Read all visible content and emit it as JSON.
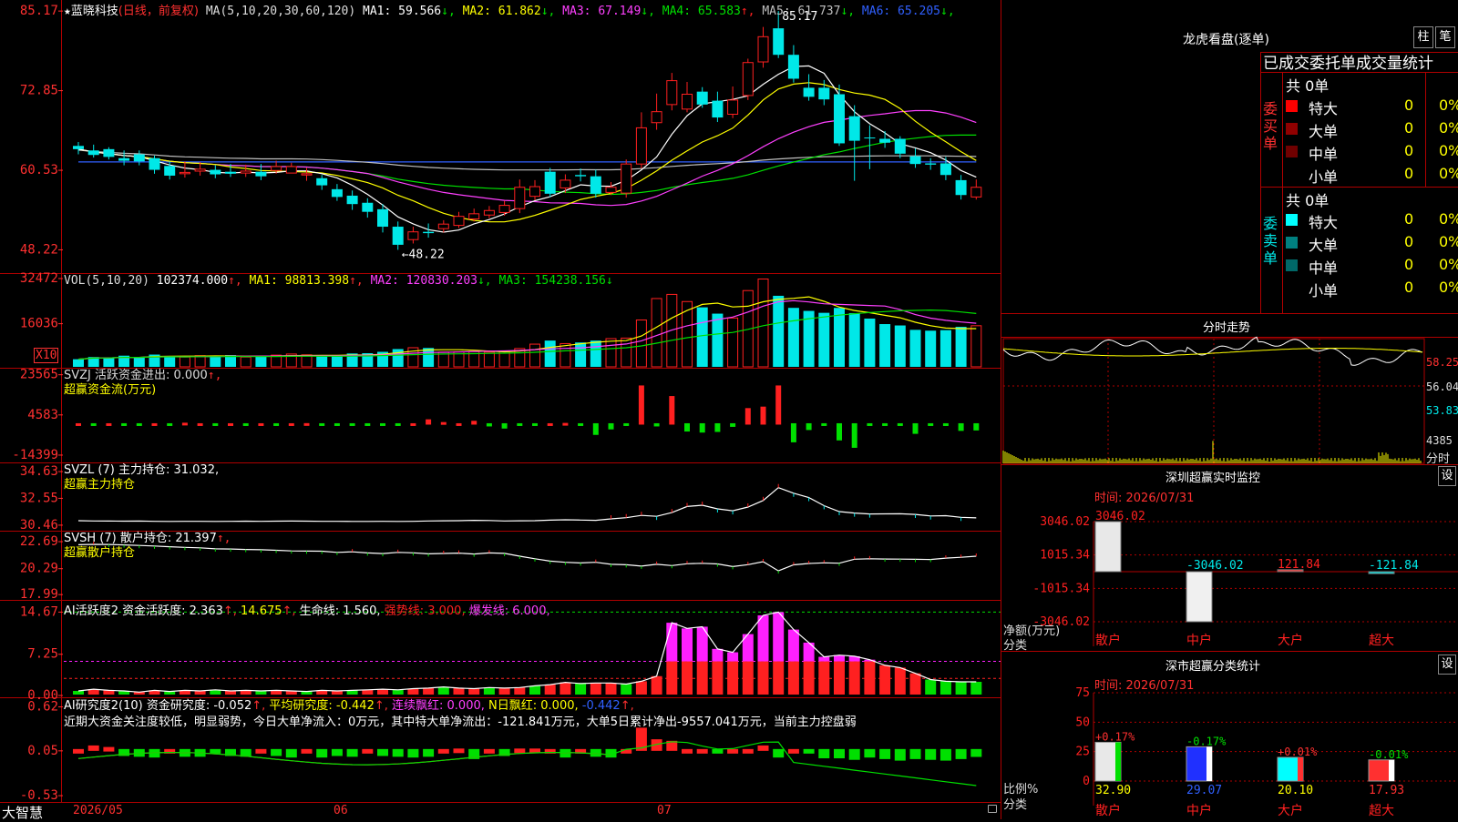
{
  "stock": {
    "name": "蓝晓科技",
    "mode": "(日线，前复权)"
  },
  "colors": {
    "up": "#ff2020",
    "down": "#00e8e8",
    "grid": "#a00000",
    "ma1": "#ffffff",
    "ma2": "#ffff00",
    "ma3": "#ff40ff",
    "ma4": "#00e000",
    "ma5": "#c0c0c0",
    "ma6": "#3060ff",
    "green": "#00e000",
    "magenta": "#ff20ff",
    "yellow": "#ffff00"
  },
  "price_panel": {
    "ma_label": "MA(5,10,20,30,60,120)",
    "ma_values": [
      {
        "label": "MA1:",
        "value": "59.566",
        "arrow": "↓",
        "color": "#ffffff"
      },
      {
        "label": "MA2:",
        "value": "61.862",
        "arrow": "↓",
        "color": "#ffff00"
      },
      {
        "label": "MA3:",
        "value": "67.149",
        "arrow": "↓",
        "color": "#ff40ff"
      },
      {
        "label": "MA4:",
        "value": "65.583",
        "arrow": "↑",
        "color": "#00e000"
      },
      {
        "label": "MA5:",
        "value": "61.737",
        "arrow": "↓",
        "color": "#c0c0c0"
      },
      {
        "label": "MA6:",
        "value": "65.205",
        "arrow": "↓",
        "color": "#3060ff"
      }
    ],
    "y_ticks": [
      "85.17",
      "72.85",
      "60.53",
      "48.22"
    ],
    "high_note": "85.17",
    "low_note": "←48.22"
  },
  "vol_panel": {
    "title": "VOL(5,10,20)",
    "value": "102374.000",
    "ma1": "MA1: 98813.398",
    "ma2": "MA2: 120830.203",
    "ma3": "MA3: 154238.156",
    "y_ticks": [
      "32472",
      "16036"
    ],
    "unit": "X10"
  },
  "svzj_panel": {
    "title": "SVZJ  活跃资金进出: 0.000",
    "subtitle": "超赢资金流(万元)",
    "y_ticks": [
      "23565",
      "4583",
      "-14399"
    ]
  },
  "svzl_panel": {
    "title": "SVZL (7) 主力持仓: 31.032,",
    "subtitle": "超赢主力持仓",
    "y_ticks": [
      "34.63",
      "32.55",
      "30.46"
    ]
  },
  "svsh_panel": {
    "title": "SVSH (7) 散户持仓: 21.397",
    "subtitle": "超赢散户持仓",
    "y_ticks": [
      "22.69",
      "20.29",
      "17.99"
    ]
  },
  "ai_active_panel": {
    "title": "AI活跃度2 资金活跃度: 2.363",
    "v2": "14.675",
    "v3": "生命线: 1.560,",
    "v4": "强势线: 3.000,",
    "v5": "爆发线: 6.000,",
    "y_ticks": [
      "14.67",
      "7.25",
      "0.00"
    ]
  },
  "ai_research_panel": {
    "title": "AI研究度2(10) 资金研究度: -0.052",
    "v2": "平均研究度: -0.442",
    "v3": "连续飘红: 0.000,",
    "v4": "N日飘红: 0.000,",
    "v5": "-0.442",
    "comment": "近期大资金关注度较低，明显弱势，今日大单净流入：0万元，其中特大单净流出：-121.841万元，大单5日累计净出-9557.041万元，当前主力控盘弱",
    "y_ticks": [
      "0.62",
      "0.05",
      "-0.53"
    ]
  },
  "x_axis": {
    "labels": [
      "2026/05",
      "06",
      "07"
    ],
    "brand": "大智慧"
  },
  "dragon": {
    "title": "龙虎看盘(逐单)",
    "btn1": "柱",
    "btn2": "笔",
    "tabs_text": "已成交委托单成交量统计",
    "buy_label": "委买单",
    "sell_label": "委卖单",
    "buy_total": "共 0单",
    "sell_total": "共 0单",
    "buy_rows": [
      {
        "name": "特大",
        "count": "0",
        "pct": "0%",
        "color": "#ff0000"
      },
      {
        "name": "大单",
        "count": "0",
        "pct": "0%",
        "color": "#900000"
      },
      {
        "name": "中单",
        "count": "0",
        "pct": "0%",
        "color": "#700000"
      },
      {
        "name": "小单",
        "count": "0",
        "pct": "0%",
        "color": ""
      }
    ],
    "sell_rows": [
      {
        "name": "特大",
        "count": "0",
        "pct": "0%",
        "color": "#00ffff"
      },
      {
        "name": "大单",
        "count": "0",
        "pct": "0%",
        "color": "#008080"
      },
      {
        "name": "中单",
        "count": "0",
        "pct": "0%",
        "color": "#006868"
      },
      {
        "name": "小单",
        "count": "0",
        "pct": "0%",
        "color": ""
      }
    ]
  },
  "intraday": {
    "title": "分时走势",
    "y_labels": [
      "58.25",
      "56.04",
      "53.83"
    ],
    "vol_label": "4385",
    "x_label": "分时"
  },
  "monitor": {
    "title": "深圳超赢实时监控",
    "btn": "设",
    "time": "时间: 2026/07/31",
    "y_ticks": [
      "3046.02",
      "1015.34",
      "-1015.34",
      "-3046.02"
    ],
    "unit": "净额(万元)",
    "cat_label": "分类"
  },
  "classify": {
    "title": "深市超赢分类统计",
    "btn": "设",
    "time": "时间: 2026/07/31",
    "y_ticks": [
      "75",
      "50",
      "25",
      "0"
    ],
    "unit": "比例%",
    "cat_label": "分类"
  },
  "chart_data": [
    {
      "type": "candlestick",
      "title": "蓝晓科技 (日线，前复权)",
      "x": [
        "2026/05",
        "06",
        "07"
      ],
      "open": [
        64.3,
        63.6,
        63.8,
        62.4,
        63.0,
        62.4,
        61.2,
        60.0,
        60.4,
        60.6,
        60.3,
        60.1,
        60.3,
        60.5,
        60.1,
        59.8,
        59.3,
        57.6,
        56.6,
        55.5,
        54.5,
        51.8,
        49.8,
        51.0,
        51.5,
        52.0,
        53.0,
        53.6,
        54.0,
        54.6,
        56.5,
        60.3,
        57.8,
        59.8,
        59.6,
        57.1,
        57.0,
        61.5,
        67.9,
        70.7,
        70.0,
        72.7,
        71.3,
        69.2,
        72.1,
        77.3,
        82.5,
        78.4,
        73.3,
        73.3,
        72.3,
        68.9,
        65.6,
        65.4,
        65.4,
        62.7,
        61.6,
        61.6,
        59.0,
        56.4
      ],
      "close": [
        63.8,
        62.9,
        62.6,
        62.0,
        61.9,
        60.6,
        59.7,
        60.2,
        60.7,
        59.9,
        60.0,
        60.4,
        59.6,
        61.1,
        61.1,
        60.0,
        58.2,
        56.4,
        55.3,
        54.1,
        51.8,
        49.0,
        51.0,
        50.8,
        52.2,
        53.4,
        53.8,
        54.3,
        55.1,
        57.9,
        58.0,
        56.9,
        59.0,
        59.6,
        56.9,
        57.9,
        61.5,
        67.1,
        69.6,
        74.4,
        72.3,
        70.7,
        68.7,
        71.4,
        77.2,
        81.2,
        78.4,
        74.7,
        71.9,
        71.5,
        64.7,
        65.1,
        65.5,
        64.8,
        63.1,
        61.5,
        61.4,
        59.8,
        56.7,
        57.9
      ],
      "high": [
        64.9,
        64.5,
        64.1,
        63.6,
        63.6,
        62.8,
        61.9,
        61.9,
        61.8,
        61.3,
        61.5,
        61.4,
        61.5,
        62.0,
        61.7,
        60.9,
        59.8,
        58.4,
        57.4,
        56.2,
        55.3,
        52.6,
        51.8,
        52.3,
        52.8,
        54.1,
        54.6,
        55.0,
        55.8,
        59.1,
        59.0,
        60.9,
        59.9,
        60.8,
        60.6,
        58.7,
        62.2,
        69.5,
        72.4,
        75.6,
        74.2,
        73.4,
        72.7,
        73.5,
        77.8,
        82.7,
        85.17,
        79.9,
        75.4,
        74.5,
        73.8,
        70.6,
        67.5,
        66.6,
        65.8,
        63.9,
        62.4,
        62.6,
        59.8,
        59.1
      ],
      "low": [
        63.0,
        62.5,
        62.2,
        61.3,
        61.3,
        60.0,
        59.1,
        59.4,
        59.7,
        59.3,
        59.5,
        59.5,
        59.0,
        60.0,
        60.1,
        58.9,
        57.5,
        55.8,
        54.4,
        53.2,
        50.9,
        48.22,
        49.2,
        50.1,
        50.9,
        51.6,
        52.6,
        53.1,
        53.5,
        53.9,
        55.9,
        56.4,
        57.0,
        58.8,
        56.3,
        56.7,
        56.3,
        60.8,
        66.8,
        69.8,
        69.5,
        70.2,
        68.0,
        68.6,
        71.4,
        76.4,
        77.9,
        74.1,
        71.3,
        70.6,
        64.3,
        58.9,
        60.7,
        64.0,
        62.4,
        60.9,
        60.6,
        59.0,
        56.0,
        56.0
      ],
      "ylim": [
        44.9,
        86.6
      ],
      "y_ticks": [
        85.17,
        72.85,
        60.53,
        48.22
      ]
    },
    {
      "type": "bar",
      "title": "VOL(5,10,20)",
      "values": [
        3100,
        3900,
        3700,
        4400,
        3800,
        4800,
        4300,
        3900,
        4400,
        4200,
        4600,
        3900,
        4100,
        4600,
        5000,
        4700,
        4100,
        4200,
        5200,
        5300,
        5800,
        6800,
        7300,
        7200,
        5700,
        5800,
        5900,
        5700,
        5900,
        7000,
        8600,
        9900,
        8800,
        9200,
        9900,
        10600,
        10800,
        17400,
        25200,
        26700,
        24100,
        22000,
        19700,
        18100,
        28100,
        32300,
        26200,
        21800,
        20700,
        20000,
        21800,
        19900,
        17900,
        15900,
        15400,
        13800,
        13500,
        13700,
        14900,
        15300
      ],
      "ylim": [
        0,
        33800
      ],
      "unit": "X10"
    },
    {
      "type": "bar",
      "title": "SVZJ 超赢资金流(万元)",
      "values": [
        120,
        -250,
        180,
        -500,
        -320,
        400,
        -180,
        900,
        500,
        -220,
        300,
        -450,
        150,
        -180,
        200,
        700,
        -350,
        -900,
        -300,
        -500,
        -200,
        -300,
        300,
        2500,
        1200,
        500,
        1800,
        -1500,
        -2500,
        -600,
        -1200,
        600,
        800,
        -900,
        -5500,
        -2900,
        -1000,
        18500,
        -1500,
        13500,
        -3900,
        -4400,
        -4100,
        -1700,
        7800,
        8500,
        18500,
        -9000,
        -3200,
        -800,
        -8100,
        -11600,
        -400,
        -800,
        -1100,
        -5000,
        -300,
        -1300,
        -3600,
        -3400
      ],
      "ylim": [
        -17000,
        26000
      ]
    },
    {
      "type": "line",
      "title": "SVZL 超赢主力持仓",
      "values": [
        30.81,
        30.79,
        30.78,
        30.77,
        30.78,
        30.76,
        30.75,
        30.76,
        30.76,
        30.75,
        30.76,
        30.77,
        30.76,
        30.77,
        30.78,
        30.77,
        30.76,
        30.76,
        30.75,
        30.75,
        30.76,
        30.75,
        30.76,
        30.79,
        30.8,
        30.81,
        30.84,
        30.82,
        30.79,
        30.8,
        30.81,
        30.85,
        30.88,
        30.86,
        30.84,
        30.95,
        31.04,
        31.22,
        31.15,
        31.44,
        31.91,
        32.01,
        31.73,
        31.58,
        31.87,
        32.38,
        33.38,
        32.95,
        32.61,
        31.98,
        31.52,
        31.4,
        31.33,
        31.34,
        31.35,
        31.3,
        31.18,
        31.2,
        31.07,
        31.03
      ],
      "ylim": [
        30.1,
        35.2
      ]
    },
    {
      "type": "line",
      "title": "SVSH 超赢散户持仓",
      "values": [
        22.42,
        22.45,
        22.44,
        22.4,
        22.35,
        22.3,
        22.24,
        22.18,
        22.14,
        22.05,
        22.04,
        22.0,
        21.97,
        21.92,
        21.87,
        21.85,
        21.84,
        21.74,
        21.79,
        21.69,
        21.63,
        21.74,
        21.7,
        21.61,
        21.64,
        21.67,
        21.59,
        21.69,
        21.65,
        21.4,
        21.17,
        20.96,
        20.86,
        20.8,
        20.86,
        20.68,
        20.64,
        20.52,
        20.68,
        20.57,
        20.73,
        20.77,
        20.71,
        20.48,
        20.65,
        20.91,
        20.1,
        20.63,
        20.75,
        20.81,
        20.78,
        21.13,
        21.17,
        21.15,
        21.14,
        21.12,
        21.11,
        21.23,
        21.3,
        21.4
      ],
      "ylim": [
        17.6,
        23.5
      ]
    },
    {
      "type": "bar",
      "title": "AI活跃度2 资金活跃度",
      "values": [
        0.8,
        1.1,
        0.9,
        0.8,
        0.6,
        0.9,
        0.7,
        0.9,
        0.8,
        1.0,
        0.8,
        0.9,
        0.8,
        0.9,
        0.8,
        0.7,
        0.9,
        0.8,
        0.9,
        1.0,
        1.1,
        1.0,
        1.2,
        1.3,
        1.5,
        1.3,
        1.2,
        1.4,
        1.3,
        1.4,
        1.7,
        1.9,
        2.3,
        2.1,
        2.2,
        2.2,
        2.0,
        2.5,
        3.4,
        12.8,
        11.8,
        12.1,
        8.2,
        7.6,
        10.8,
        14.1,
        14.675,
        11.6,
        9.3,
        6.8,
        7.1,
        6.9,
        6.3,
        5.3,
        4.9,
        3.9,
        2.8,
        2.5,
        2.4,
        2.4
      ],
      "ylim": [
        0,
        16.5
      ]
    },
    {
      "type": "bar",
      "title": "AI研究度2(10) 资金研究度",
      "values": [
        0.05,
        0.12,
        0.1,
        -0.04,
        -0.05,
        -0.06,
        0.07,
        -0.05,
        -0.05,
        0.03,
        -0.04,
        -0.05,
        0.06,
        -0.04,
        -0.06,
        0.05,
        -0.06,
        -0.04,
        -0.05,
        0.05,
        -0.04,
        -0.05,
        -0.06,
        -0.05,
        0.06,
        0.08,
        -0.08,
        0.06,
        -0.04,
        0.08,
        0.08,
        0.05,
        -0.06,
        0.06,
        -0.05,
        -0.06,
        0.05,
        0.35,
        0.2,
        0.18,
        0.06,
        0.05,
        0.04,
        0.05,
        0.05,
        0.12,
        -0.06,
        0.05,
        0.04,
        -0.07,
        -0.07,
        -0.09,
        -0.06,
        -0.08,
        -0.1,
        -0.08,
        -0.09,
        -0.1,
        -0.08,
        -0.052
      ],
      "ylim": [
        -0.6,
        0.72
      ]
    },
    {
      "type": "bar",
      "title": "深圳超赢实时监控",
      "categories": [
        "散户",
        "中户",
        "大户",
        "超大"
      ],
      "values": [
        3046.02,
        -3046.02,
        121.84,
        -121.84
      ],
      "ylim": [
        -3046.02,
        3046.02
      ]
    },
    {
      "type": "bar",
      "title": "深市超赢分类统计",
      "categories": [
        "散户",
        "中户",
        "大户",
        "超大"
      ],
      "values": [
        32.9,
        29.07,
        20.1,
        17.93
      ],
      "changes": [
        "+0.17%",
        "-0.17%",
        "+0.01%",
        "-0.01%"
      ],
      "ylim": [
        0,
        75
      ]
    }
  ]
}
